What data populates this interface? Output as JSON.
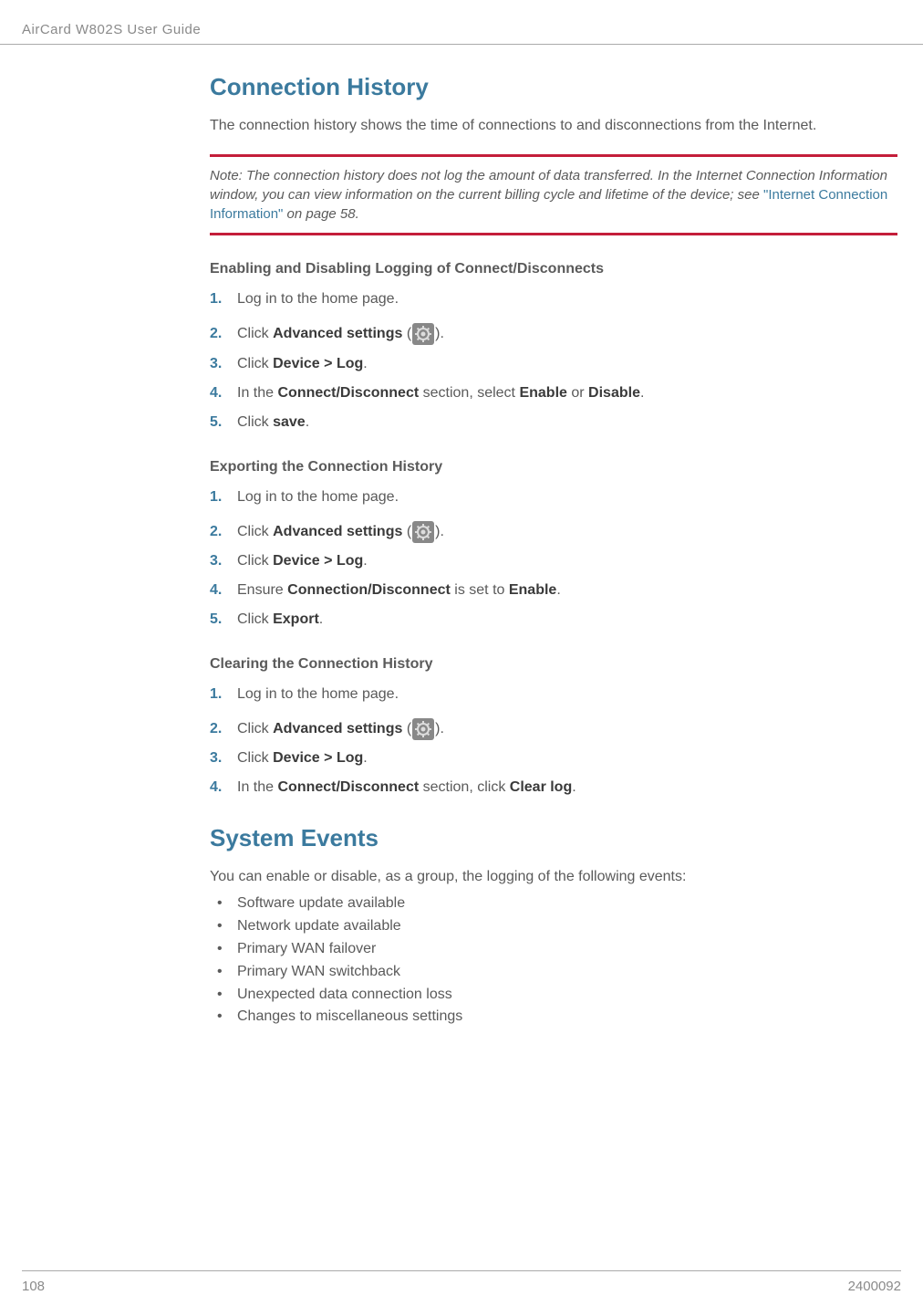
{
  "header": {
    "guide_title": "AirCard W802S User Guide"
  },
  "section1": {
    "title": "Connection History",
    "intro": "The connection history shows the time of connections to and disconnections from the Internet.",
    "note_prefix": "Note:  ",
    "note_body_a": "The connection history does not log the amount of data transferred. In the Internet Connection Information window, you can view information on the current billing cycle and lifetime of the device; see ",
    "note_link": "\"Internet Connection Information\"",
    "note_body_b": " on page 58.",
    "sub1": {
      "title": "Enabling and Disabling Logging of Connect/Disconnects",
      "steps": {
        "s1": "Log in to the home page.",
        "s2_a": "Click ",
        "s2_b": "Advanced settings",
        "s2_c": " (",
        "s2_d": ").",
        "s3_a": "Click ",
        "s3_b": "Device > Log",
        "s3_c": ".",
        "s4_a": "In the ",
        "s4_b": "Connect/Disconnect",
        "s4_c": " section, select ",
        "s4_d": "Enable",
        "s4_e": " or ",
        "s4_f": "Disable",
        "s4_g": ".",
        "s5_a": "Click ",
        "s5_b": "save",
        "s5_c": "."
      }
    },
    "sub2": {
      "title": "Exporting the Connection History",
      "steps": {
        "s1": "Log in to the home page.",
        "s2_a": "Click ",
        "s2_b": "Advanced settings",
        "s2_c": " (",
        "s2_d": ").",
        "s3_a": "Click ",
        "s3_b": "Device > Log",
        "s3_c": ".",
        "s4_a": "Ensure ",
        "s4_b": "Connection/Disconnect",
        "s4_c": " is set to ",
        "s4_d": "Enable",
        "s4_e": ".",
        "s5_a": "Click ",
        "s5_b": "Export",
        "s5_c": "."
      }
    },
    "sub3": {
      "title": "Clearing the Connection History",
      "steps": {
        "s1": "Log in to the home page.",
        "s2_a": "Click ",
        "s2_b": "Advanced settings",
        "s2_c": " (",
        "s2_d": ").",
        "s3_a": "Click ",
        "s3_b": "Device > Log",
        "s3_c": ".",
        "s4_a": "In the ",
        "s4_b": "Connect/Disconnect",
        "s4_c": " section, click ",
        "s4_d": "Clear log",
        "s4_e": "."
      }
    }
  },
  "section2": {
    "title": "System Events",
    "intro": "You can enable or disable, as a group, the logging of the following events:",
    "bullets": {
      "b1": "Software update available",
      "b2": "Network update available",
      "b3": "Primary WAN failover",
      "b4": "Primary WAN switchback",
      "b5": "Unexpected data connection loss",
      "b6": "Changes to miscellaneous settings"
    }
  },
  "footer": {
    "page": "108",
    "docnum": "2400092"
  }
}
